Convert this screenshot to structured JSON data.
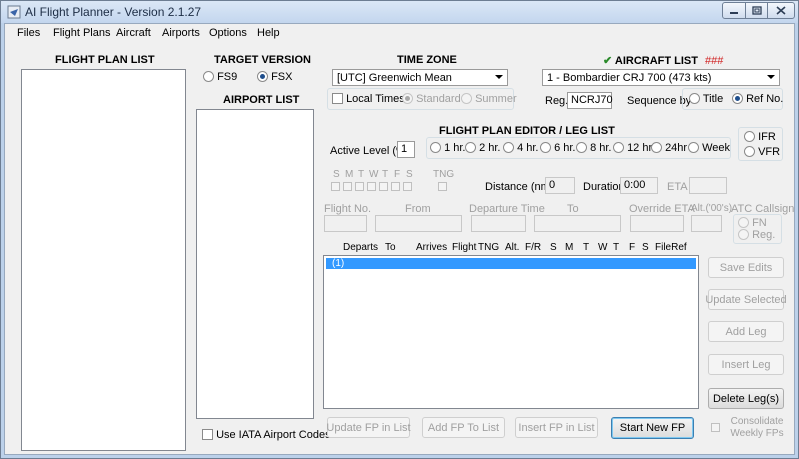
{
  "window": {
    "title": "AI Flight Planner - Version 2.1.27"
  },
  "menu": [
    "Files",
    "Flight Plans",
    "Aircraft",
    "Airports",
    "Options",
    "Help"
  ],
  "flight_plan_list": {
    "header": "FLIGHT PLAN LIST"
  },
  "target_version": {
    "header": "TARGET VERSION",
    "fs9": "FS9",
    "fsx": "FSX",
    "selected": "FSX"
  },
  "airport_list": {
    "header": "AIRPORT LIST",
    "use_iata": "Use IATA Airport Codes"
  },
  "time_zone": {
    "header": "TIME ZONE",
    "value": "[UTC] Greenwich Mean",
    "local_times": "Local Times",
    "standard": "Standard",
    "summer": "Summer"
  },
  "aircraft_list": {
    "header": "AIRCRAFT LIST",
    "marker": "###",
    "check": "✔",
    "value": "1 - Bombardier CRJ 700 (473 kts)",
    "reg_label": "Reg.",
    "reg_value": "NCRJ70",
    "sequence_label": "Sequence by",
    "title_opt": "Title",
    "refno_opt": "Ref No.",
    "selected": "Ref No."
  },
  "editor": {
    "header": "FLIGHT PLAN EDITOR / LEG LIST",
    "active_level_label": "Active Level (%)",
    "active_level_value": "1",
    "intervals": [
      "1 hr.",
      "2 hr.",
      "4 hr.",
      "6 hr.",
      "8 hr.",
      "12 hr",
      "24hr",
      "Week"
    ],
    "ifr": "IFR",
    "vfr": "VFR",
    "days": [
      "S",
      "M",
      "T",
      "W",
      "T",
      "F",
      "S"
    ],
    "tng": "TNG",
    "distance_label": "Distance (nm)",
    "distance_value": "0",
    "duration_label": "Duration",
    "duration_value": "0:00",
    "eta_label": "ETA",
    "fields": {
      "flight_no": "Flight No.",
      "from": "From",
      "departure_time": "Departure Time",
      "to": "To",
      "override_eta": "Override ETA",
      "alt": "Alt.('00's)",
      "atc_callsign": "ATC Callsign",
      "fn": "FN",
      "reg": "Reg."
    },
    "columns": [
      "Departs",
      "To",
      "Arrives",
      "Flight",
      "TNG",
      "Alt.",
      "F/R",
      "S",
      "M",
      "T",
      "W",
      "T",
      "F",
      "S",
      "FileRef"
    ],
    "rows": [
      "(1)"
    ]
  },
  "side_buttons": {
    "save_edits": "Save Edits",
    "update_selected": "Update Selected",
    "add_leg": "Add Leg",
    "insert_leg": "Insert Leg",
    "delete_legs": "Delete Leg(s)",
    "consolidate": "Consolidate Weekly FPs"
  },
  "bottom_buttons": {
    "update_fp": "Update FP in List",
    "add_fp": "Add FP To List",
    "insert_fp": "Insert FP in List",
    "start_new": "Start New FP"
  },
  "colors": {
    "selection": "#3399ff",
    "marker": "#d02020",
    "check": "#2a8a2a"
  }
}
